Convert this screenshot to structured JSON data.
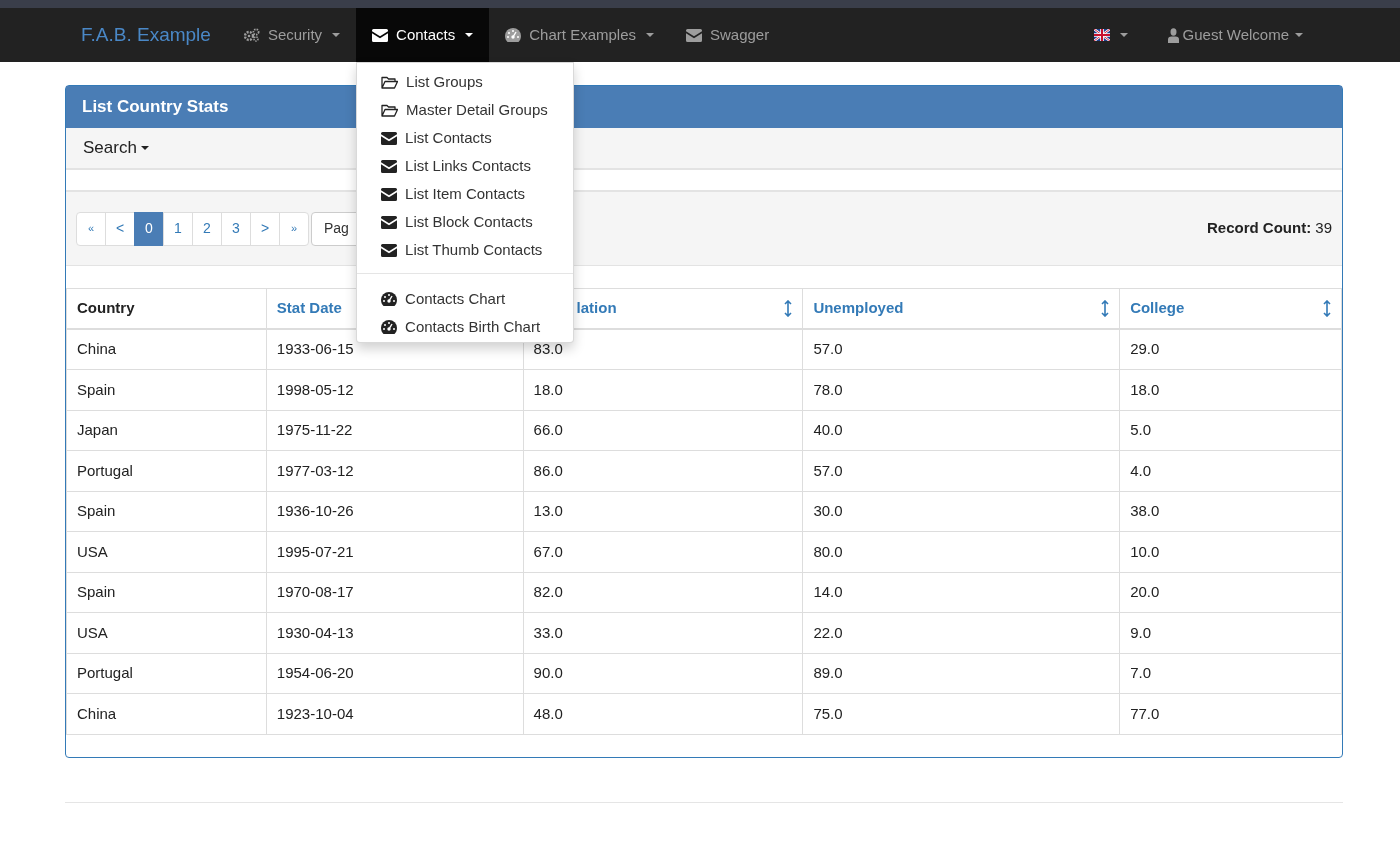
{
  "navbar": {
    "brand": "F.A.B. Example",
    "items": [
      {
        "label": "Security",
        "kind": "gears",
        "caret": true,
        "selected": false
      },
      {
        "label": "Contacts",
        "kind": "envelope",
        "caret": true,
        "selected": true
      },
      {
        "label": "Chart Examples",
        "kind": "dashboard",
        "caret": true,
        "selected": false
      },
      {
        "label": "Swagger",
        "kind": "envelope",
        "caret": false,
        "selected": false
      }
    ],
    "language": {
      "kind": "flag",
      "caret": true
    },
    "user": {
      "label": "Guest Welcome",
      "kind": "user",
      "caret": true
    }
  },
  "dropdown": {
    "groups": [
      [
        {
          "label": "List Groups",
          "kind": "folder"
        },
        {
          "label": "Master Detail Groups",
          "kind": "folder"
        },
        {
          "label": "List Contacts",
          "kind": "envelope"
        },
        {
          "label": "List Links Contacts",
          "kind": "envelope"
        },
        {
          "label": "List Item Contacts",
          "kind": "envelope"
        },
        {
          "label": "List Block Contacts",
          "kind": "envelope"
        },
        {
          "label": "List Thumb Contacts",
          "kind": "envelope"
        }
      ],
      [
        {
          "label": "Contacts Chart",
          "kind": "dashboard"
        },
        {
          "label": "Contacts Birth Chart",
          "kind": "dashboard"
        }
      ]
    ]
  },
  "panel": {
    "title": "List Country Stats",
    "search": "Search",
    "pagination": [
      {
        "label": "«",
        "selected": false
      },
      {
        "label": "<",
        "selected": false
      },
      {
        "label": "0",
        "selected": true
      },
      {
        "label": "1",
        "selected": false
      },
      {
        "label": "2",
        "selected": false
      },
      {
        "label": "3",
        "selected": false
      },
      {
        "label": ">",
        "selected": false
      },
      {
        "label": "»",
        "selected": false
      }
    ],
    "page_button": "Pag",
    "record_count": {
      "label": "Record Count:",
      "value": "39"
    },
    "table": {
      "columns": [
        {
          "label": "Country",
          "link": false,
          "sort_icon": false
        },
        {
          "label": "Stat Date",
          "link": true,
          "sort_icon": false
        },
        {
          "label": "lation",
          "link": true,
          "sort_icon": true
        },
        {
          "label": "Unemployed",
          "link": true,
          "sort_icon": true
        },
        {
          "label": "College",
          "link": true,
          "sort_icon": true
        }
      ],
      "rows": [
        [
          "China",
          "1933-06-15",
          "83.0",
          "57.0",
          "29.0"
        ],
        [
          "Spain",
          "1998-05-12",
          "18.0",
          "78.0",
          "18.0"
        ],
        [
          "Japan",
          "1975-11-22",
          "66.0",
          "40.0",
          "5.0"
        ],
        [
          "Portugal",
          "1977-03-12",
          "86.0",
          "57.0",
          "4.0"
        ],
        [
          "Spain",
          "1936-10-26",
          "13.0",
          "30.0",
          "38.0"
        ],
        [
          "USA",
          "1995-07-21",
          "67.0",
          "80.0",
          "10.0"
        ],
        [
          "Spain",
          "1970-08-17",
          "82.0",
          "14.0",
          "20.0"
        ],
        [
          "USA",
          "1930-04-13",
          "33.0",
          "22.0",
          "9.0"
        ],
        [
          "Portugal",
          "1954-06-20",
          "90.0",
          "89.0",
          "7.0"
        ],
        [
          "China",
          "1923-10-04",
          "48.0",
          "75.0",
          "77.0"
        ]
      ]
    }
  }
}
